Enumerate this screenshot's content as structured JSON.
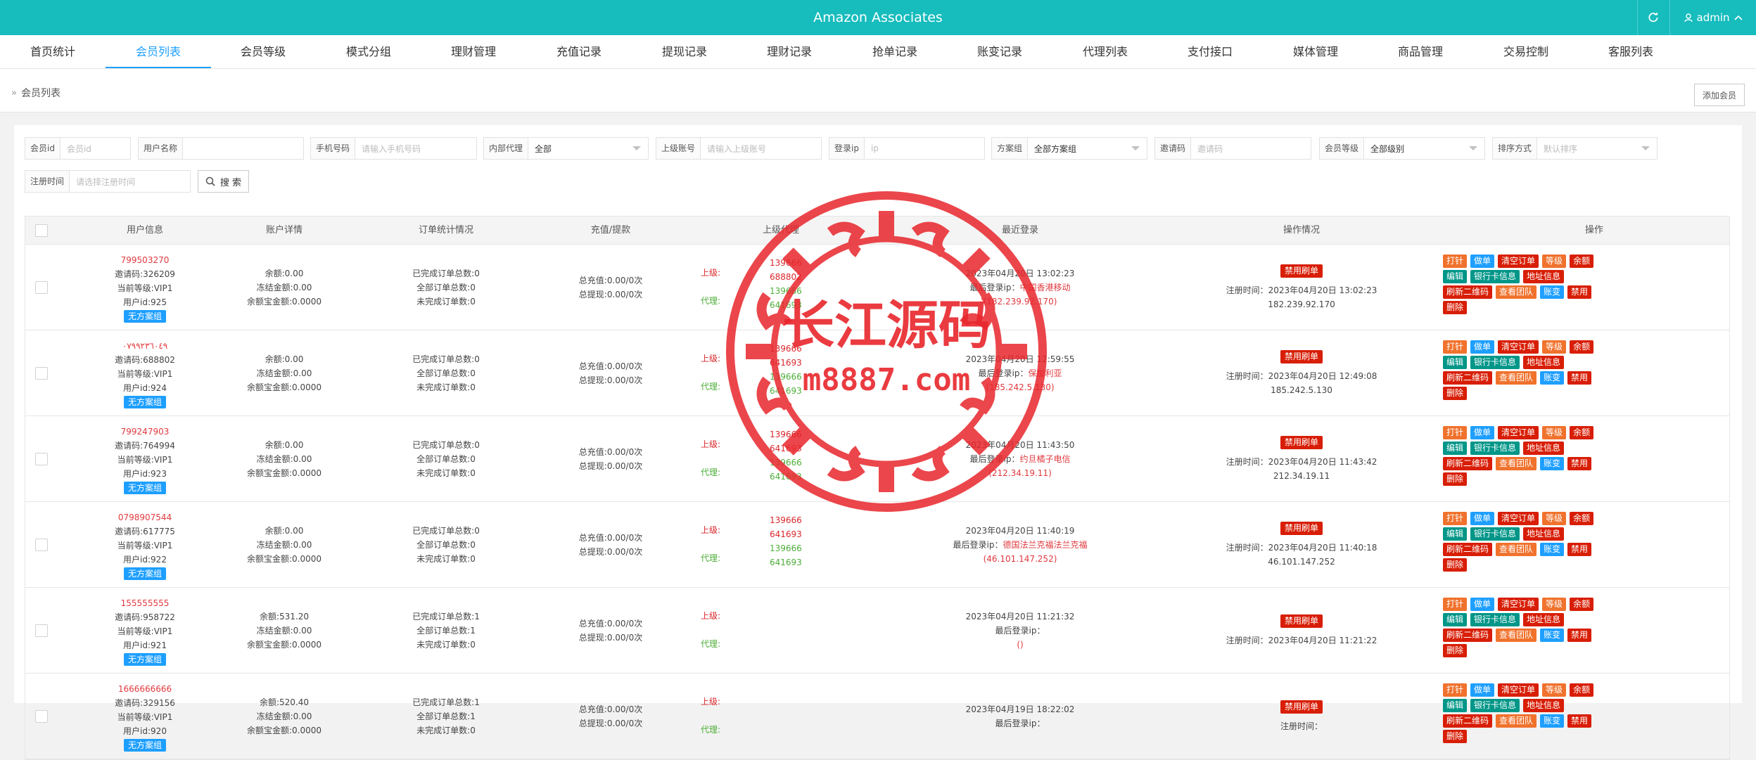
{
  "header": {
    "title": "Amazon Associates",
    "user": "admin"
  },
  "nav": [
    {
      "label": "首页统计"
    },
    {
      "label": "会员列表",
      "active": true
    },
    {
      "label": "会员等级"
    },
    {
      "label": "模式分组"
    },
    {
      "label": "理财管理"
    },
    {
      "label": "充值记录"
    },
    {
      "label": "提现记录"
    },
    {
      "label": "理财记录"
    },
    {
      "label": "抢单记录"
    },
    {
      "label": "账变记录"
    },
    {
      "label": "代理列表"
    },
    {
      "label": "支付接口"
    },
    {
      "label": "媒体管理"
    },
    {
      "label": "商品管理"
    },
    {
      "label": "交易控制"
    },
    {
      "label": "客服列表"
    }
  ],
  "breadcrumb": "会员列表",
  "add_button": "添加会员",
  "filters": {
    "member_id": {
      "label": "会员id",
      "placeholder": "会员id"
    },
    "username": {
      "label": "用户名称",
      "placeholder": ""
    },
    "phone": {
      "label": "手机号码",
      "placeholder": "请输入手机号码"
    },
    "agent": {
      "label": "内部代理",
      "value": "全部"
    },
    "parent": {
      "label": "上级账号",
      "placeholder": "请输入上级账号"
    },
    "login_ip": {
      "label": "登录ip",
      "placeholder": "ip"
    },
    "plan_group": {
      "label": "方案组",
      "value": "全部方案组"
    },
    "invite": {
      "label": "邀请码",
      "placeholder": "邀请码"
    },
    "level": {
      "label": "会员等级",
      "value": "全部级别"
    },
    "sort": {
      "label": "排序方式",
      "value": "默认排序"
    },
    "reg_time": {
      "label": "注册时间",
      "placeholder": "请选择注册时间"
    },
    "search_label": "搜 索"
  },
  "columns": [
    "用户信息",
    "账户详情",
    "订单统计情况",
    "充值/提款",
    "上级代理",
    "最近登录",
    "操作情况",
    "操作"
  ],
  "row_labels": {
    "invite_prefix": "邀请码:",
    "level_prefix": "当前等级:",
    "uid_prefix": "用户id:",
    "balance_prefix": "余额:",
    "frozen_prefix": "冻结金额:",
    "yeb_prefix": "余额宝金额:",
    "done_prefix": "已完成订单总数:",
    "all_prefix": "全部订单总数:",
    "undone_prefix": "未完成订单数:",
    "recharge_prefix": "总充值:",
    "withdraw_prefix": "总提现:",
    "up_label": "上级:",
    "agent_label": "代理:",
    "reg_prefix": "注册时间：",
    "login_ip_prefix": "最后登录ip："
  },
  "ops": [
    "打针",
    "做单",
    "清空订单",
    "等级",
    "余额",
    "编辑",
    "银行卡信息",
    "地址信息",
    "刷新二维码",
    "查看团队",
    "账变",
    "禁用",
    "删除"
  ],
  "rows": [
    {
      "username": "799503270",
      "invite": "326209",
      "level": "VIP1",
      "uid": "925",
      "group": "无方案组",
      "balance": "0.00",
      "frozen": "0.00",
      "yeb": "0.0000",
      "done": "0",
      "all": "0",
      "undone": "0",
      "recharge": "0.00/0次",
      "withdraw": "0.00/0次",
      "uplines": [
        "139666",
        "688802",
        "139666",
        "641693"
      ],
      "login_time": "2023年04月20日 13:02:23",
      "login_loc": "中国香港移动",
      "login_ip": "(182.239.92.170)",
      "ban": "禁用刷单",
      "reg_time": "2023年04月20日 13:02:23",
      "reg_ip": "182.239.92.170"
    },
    {
      "username": "٠٧٩٩٢٣٦٠٤٩",
      "invite": "688802",
      "level": "VIP1",
      "uid": "924",
      "group": "无方案组",
      "balance": "0.00",
      "frozen": "0.00",
      "yeb": "0.0000",
      "done": "0",
      "all": "0",
      "undone": "0",
      "recharge": "0.00/0次",
      "withdraw": "0.00/0次",
      "uplines": [
        "139666",
        "641693",
        "139666",
        "641693"
      ],
      "login_time": "2023年04月20日 12:59:55",
      "login_loc": "保加利亚",
      "login_ip": "(185.242.5.130)",
      "ban": "禁用刷单",
      "reg_time": "2023年04月20日 12:49:08",
      "reg_ip": "185.242.5.130"
    },
    {
      "username": "799247903",
      "invite": "764994",
      "level": "VIP1",
      "uid": "923",
      "group": "无方案组",
      "balance": "0.00",
      "frozen": "0.00",
      "yeb": "0.0000",
      "done": "0",
      "all": "0",
      "undone": "0",
      "recharge": "0.00/0次",
      "withdraw": "0.00/0次",
      "uplines": [
        "139666",
        "641693",
        "139666",
        "641693"
      ],
      "login_time": "2023年04月20日 11:43:50",
      "login_loc": "约旦橘子电信",
      "login_ip": "(212.34.19.11)",
      "ban": "禁用刷单",
      "reg_time": "2023年04月20日 11:43:42",
      "reg_ip": "212.34.19.11"
    },
    {
      "username": "0798907544",
      "invite": "617775",
      "level": "VIP1",
      "uid": "922",
      "group": "无方案组",
      "balance": "0.00",
      "frozen": "0.00",
      "yeb": "0.0000",
      "done": "0",
      "all": "0",
      "undone": "0",
      "recharge": "0.00/0次",
      "withdraw": "0.00/0次",
      "uplines": [
        "139666",
        "641693",
        "139666",
        "641693"
      ],
      "login_time": "2023年04月20日 11:40:19",
      "login_loc": "德国法兰克福法兰克福",
      "login_ip": "(46.101.147.252)",
      "ban": "禁用刷单",
      "reg_time": "2023年04月20日 11:40:18",
      "reg_ip": "46.101.147.252"
    },
    {
      "username": "155555555",
      "invite": "958722",
      "level": "VIP1",
      "uid": "921",
      "group": "无方案组",
      "balance": "531.20",
      "frozen": "0.00",
      "yeb": "0.0000",
      "done": "1",
      "all": "1",
      "undone": "0",
      "recharge": "0.00/0次",
      "withdraw": "0.00/0次",
      "uplines": [],
      "login_time": "2023年04月20日 11:21:32",
      "login_loc": "",
      "login_ip": "()",
      "ban": "禁用刷单",
      "reg_time": "2023年04月20日 11:21:22",
      "reg_ip": ""
    },
    {
      "username": "1666666666",
      "invite": "329156",
      "level": "VIP1",
      "uid": "920",
      "group": "无方案组",
      "balance": "520.40",
      "frozen": "0.00",
      "yeb": "0.0000",
      "done": "1",
      "all": "1",
      "undone": "0",
      "recharge": "0.00/0次",
      "withdraw": "0.00/0次",
      "uplines": [],
      "login_time": "2023年04月19日 18:22:02",
      "login_loc": "",
      "login_ip": "",
      "ban": "禁用刷单",
      "reg_time": "",
      "reg_ip": ""
    }
  ],
  "watermark": {
    "line1": "长江源码",
    "line2": "m8887.com",
    "color": "#e8262c"
  },
  "colors": {
    "topbar": "#17bcbd",
    "accent": "#1e9fff"
  }
}
